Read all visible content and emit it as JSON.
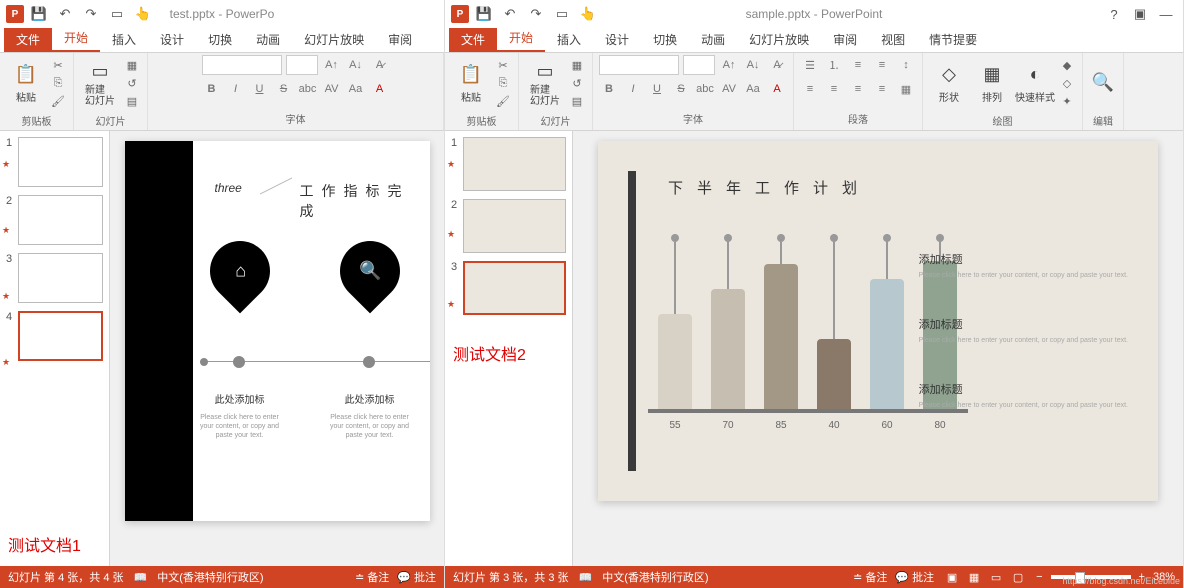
{
  "win1": {
    "title": "test.pptx - PowerPo",
    "appIcon": "P",
    "tabs": {
      "file": "文件",
      "home": "开始",
      "insert": "插入",
      "design": "设计",
      "transitions": "切换",
      "animations": "动画",
      "slideshow": "幻灯片放映",
      "review": "审阅"
    },
    "ribbon": {
      "clipboard": {
        "paste": "粘贴",
        "label": "剪贴板"
      },
      "slides": {
        "newSlide": "新建\n幻灯片",
        "label": "幻灯片"
      },
      "font": {
        "label": "字体",
        "bold": "B",
        "italic": "I",
        "underline": "U",
        "strike": "S",
        "shadow": "abc",
        "spacing": "AV",
        "case": "Aa",
        "color": "A"
      }
    },
    "thumbs": [
      {
        "num": "1"
      },
      {
        "num": "2"
      },
      {
        "num": "3"
      },
      {
        "num": "4"
      }
    ],
    "slide": {
      "tag": "three",
      "heading": "工作指标完成",
      "sub1": "此处添加标",
      "sub2": "此处添加标",
      "text1": "Please click here to enter your content, or copy and paste your text.",
      "text2": "Please click here to enter your content, or copy and paste your text."
    },
    "testLabel": "测试文档1",
    "status": {
      "slide": "幻灯片 第 4 张，共 4 张",
      "lang": "中文(香港特别行政区)",
      "notes": "备注",
      "comments": "批注"
    }
  },
  "win2": {
    "title": "sample.pptx - PowerPoint",
    "appIcon": "P",
    "help": "?",
    "tabs": {
      "file": "文件",
      "home": "开始",
      "insert": "插入",
      "design": "设计",
      "transitions": "切换",
      "animations": "动画",
      "slideshow": "幻灯片放映",
      "review": "审阅",
      "view": "视图",
      "storyline": "情节提要"
    },
    "ribbon": {
      "clipboard": {
        "paste": "粘贴",
        "label": "剪贴板"
      },
      "slides": {
        "newSlide": "新建\n幻灯片",
        "label": "幻灯片"
      },
      "font": {
        "label": "字体",
        "bold": "B",
        "italic": "I",
        "underline": "U",
        "strike": "S",
        "shadow": "abc",
        "spacing": "AV",
        "case": "Aa",
        "color": "A"
      },
      "paragraph": {
        "label": "段落"
      },
      "drawing": {
        "shapes": "形状",
        "arrange": "排列",
        "quickStyles": "快速样式",
        "label": "绘图"
      },
      "editing": {
        "label": "编辑"
      }
    },
    "thumbs": [
      {
        "num": "1"
      },
      {
        "num": "2"
      },
      {
        "num": "3"
      }
    ],
    "slide": {
      "title": "下半年工作计划",
      "side1": {
        "title": "添加标题",
        "text": "Please click here to enter your content, or copy and paste your text."
      },
      "side2": {
        "title": "添加标题",
        "text": "Please click here to enter your content, or copy and paste your text."
      },
      "side3": {
        "title": "添加标题",
        "text": "Please click here to enter your content, or copy and paste your text."
      }
    },
    "testLabel": "测试文档2",
    "status": {
      "slide": "幻灯片 第 3 张，共 3 张",
      "lang": "中文(香港特别行政区)",
      "notes": "备注",
      "comments": "批注",
      "zoom": "38%"
    }
  },
  "chart_data": {
    "type": "bar",
    "title": "下半年工作计划",
    "categories": [
      "55",
      "70",
      "85",
      "40",
      "60",
      "80"
    ],
    "values": [
      55,
      70,
      85,
      40,
      60,
      80
    ],
    "colors": [
      "#d8d2c6",
      "#c6beb0",
      "#a39886",
      "#8a7968",
      "#b8c8cf",
      "#8fa390"
    ],
    "ylim": [
      0,
      100
    ]
  },
  "watermark": "https://blog.csdn.net/Eiceblue"
}
